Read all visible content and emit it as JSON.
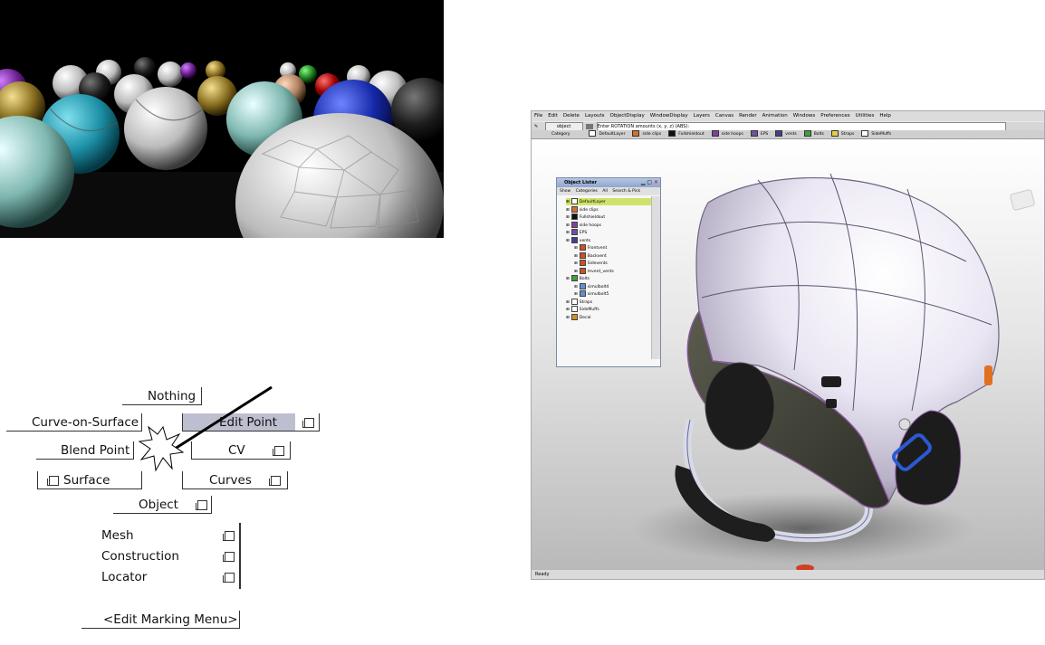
{
  "marking_menu": {
    "nothing": "Nothing",
    "curve_on_surface": "Curve-on-Surface",
    "edit_point": "Edit Point",
    "blend_point": "Blend Point",
    "cv": "CV",
    "surface": "Surface",
    "curves": "Curves",
    "object": "Object",
    "mesh": "Mesh",
    "construction": "Construction",
    "locator": "Locator",
    "edit_marking_menu": "<Edit Marking Menu>"
  },
  "alias": {
    "menu": [
      "File",
      "Edit",
      "Delete",
      "Layouts",
      "ObjectDisplay",
      "WindowDisplay",
      "Layers",
      "Canvas",
      "Render",
      "Animation",
      "Windows",
      "Preferences",
      "Utilities",
      "Help"
    ],
    "pick_mode": "object",
    "prompt": "Enter ROTATION amounts (x, y, z) (ABS):",
    "shelf_category": "Category",
    "shelf_layers": [
      "DefaultLayer",
      "side clips",
      "Fullshieldout",
      "side hoops",
      "EPS",
      "vents",
      "Bolts",
      "Straps",
      "SideMuffs"
    ],
    "status": "Ready",
    "object_lister": {
      "title": "Object Lister",
      "show": "Show",
      "categories": "Categories",
      "all": "All",
      "search": "Search & Pick",
      "items": [
        {
          "label": "DefaultLayer",
          "color": "#ffffff",
          "selected": true
        },
        {
          "label": "side clips",
          "color": "#d07030"
        },
        {
          "label": "Fullshieldout",
          "color": "#111111"
        },
        {
          "label": "side hoops",
          "color": "#8040a0"
        },
        {
          "label": "EPS",
          "color": "#7050a0"
        },
        {
          "label": "vents",
          "color": "#404090"
        },
        {
          "label": "Frontvent",
          "color": "#d05020"
        },
        {
          "label": "Backvent",
          "color": "#d05020"
        },
        {
          "label": "Sidevents",
          "color": "#d05020"
        },
        {
          "label": "mvent_vents",
          "color": "#d05020"
        },
        {
          "label": "Bolts",
          "color": "#40a040"
        },
        {
          "label": "simulbolt4",
          "color": "#6090d0"
        },
        {
          "label": "simulbolt5",
          "color": "#6090d0"
        },
        {
          "label": "Straps",
          "color": "#ffffff"
        },
        {
          "label": "SideMuffs",
          "color": "#ffffff"
        },
        {
          "label": "Decal",
          "color": "#d09020"
        }
      ]
    }
  }
}
